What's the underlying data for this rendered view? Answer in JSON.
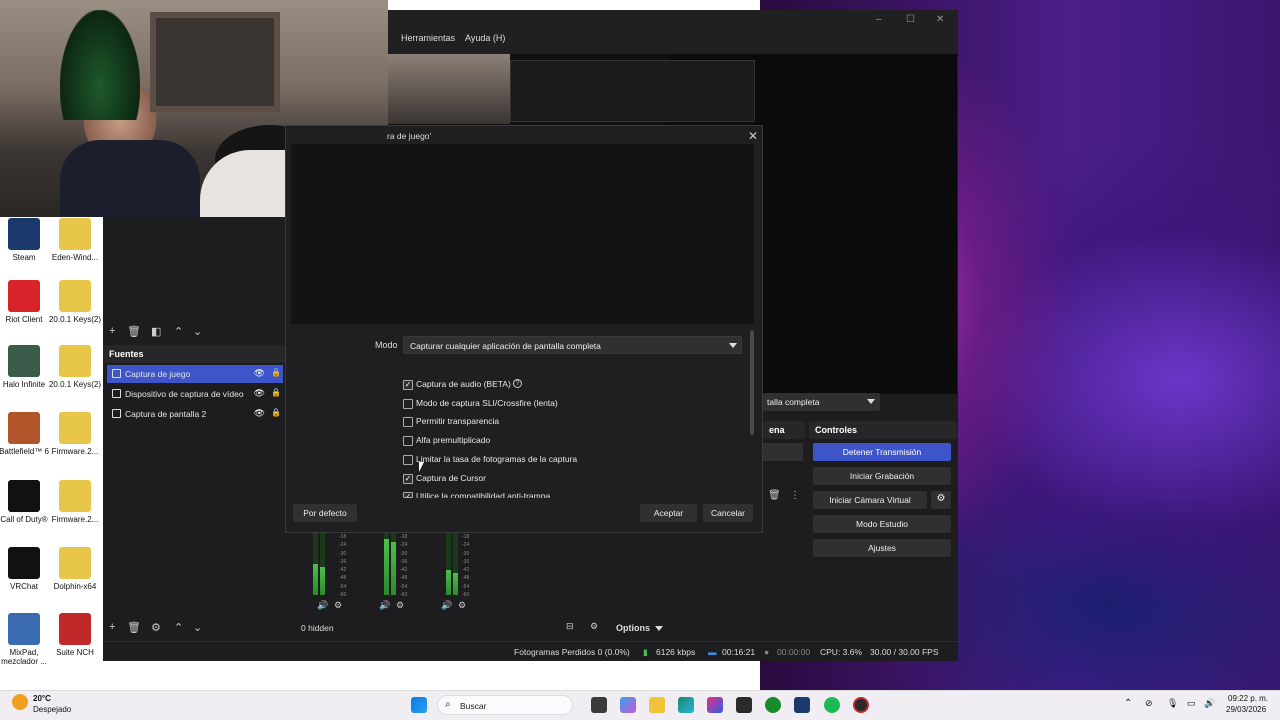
{
  "desktop": {
    "icons": [
      {
        "label": "Steam",
        "color": "#1b3a6b"
      },
      {
        "label": "Eden-Wind...",
        "color": "#e8c64a"
      },
      {
        "label": "Riot Client",
        "color": "#d8232a"
      },
      {
        "label": "20.0.1 Keys(2)",
        "color": "#e8c64a"
      },
      {
        "label": "Halo Infinite",
        "color": "#3a5a4a"
      },
      {
        "label": "20.0.1 Keys(2)",
        "color": "#e8c64a"
      },
      {
        "label": "Battlefield™ 6",
        "color": "#b0552a"
      },
      {
        "label": "Firmware.2...",
        "color": "#e8c64a"
      },
      {
        "label": "Call of Duty®",
        "color": "#111111"
      },
      {
        "label": "Firmware.2...",
        "color": "#e8c64a"
      },
      {
        "label": "VRChat",
        "color": "#111111"
      },
      {
        "label": "Dolphin-x64",
        "color": "#e8c64a"
      },
      {
        "label": "MixPad, mezclador ...",
        "color": "#3a6ab0"
      },
      {
        "label": "Suite NCH",
        "color": "#c0282a"
      }
    ]
  },
  "obs": {
    "menu": {
      "herramientas": "Herramientas",
      "ayuda": "Ayuda (H)"
    },
    "sources_header": "Fuentes",
    "sources": [
      {
        "label": "Captura de juego"
      },
      {
        "label": "Dispositivo de captura de vídeo"
      },
      {
        "label": "Captura de pantalla 2"
      }
    ],
    "scene_transition_value": "talla completa",
    "scenes_label_fragment": "ena",
    "controls_header": "Controles",
    "controls": {
      "stop_stream": "Detener Transmisión",
      "start_recording": "Iniciar Grabación",
      "start_virtual_cam": "Iniciar Cámara Virtual",
      "studio_mode": "Modo Estudio",
      "settings": "Ajustes"
    },
    "mixer": {
      "hidden": "0 hidden",
      "options": "Options",
      "scale": [
        "-18",
        "-24",
        "-30",
        "-36",
        "-42",
        "-48",
        "-54",
        "-60"
      ]
    },
    "status": {
      "dropped_frames": "Fotogramas Perdidos 0 (0.0%)",
      "bitrate": "6126 kbps",
      "stream_time": "00:16:21",
      "rec_time": "00:00:00",
      "cpu": "CPU: 3.6%",
      "fps": "30.00 / 30.00 FPS"
    }
  },
  "dialog": {
    "title": "ra de juego'",
    "mode_label": "Modo",
    "mode_value": "Capturar cualquier aplicación de pantalla completa",
    "checkboxes": [
      {
        "label": "Captura de audio (BETA)",
        "checked": true
      },
      {
        "label": "Modo de captura SLI/Crossfire (lenta)",
        "checked": false
      },
      {
        "label": "Permitir transparencia",
        "checked": false
      },
      {
        "label": "Alfa premultiplicado",
        "checked": false
      },
      {
        "label": "Limitar la tasa de fotogramas de la captura",
        "checked": false
      },
      {
        "label": "Captura de Cursor",
        "checked": true
      },
      {
        "label": "Utilice la compatibilidad anti-trampa",
        "checked": true
      }
    ],
    "defaults_button": "Por defecto",
    "ok_button": "Aceptar",
    "cancel_button": "Cancelar"
  },
  "taskbar": {
    "weather_temp": "20°C",
    "weather_desc": "Despejado",
    "search_placeholder": "Buscar",
    "time": "09:22 p. m.",
    "date": "29/03/2026"
  }
}
